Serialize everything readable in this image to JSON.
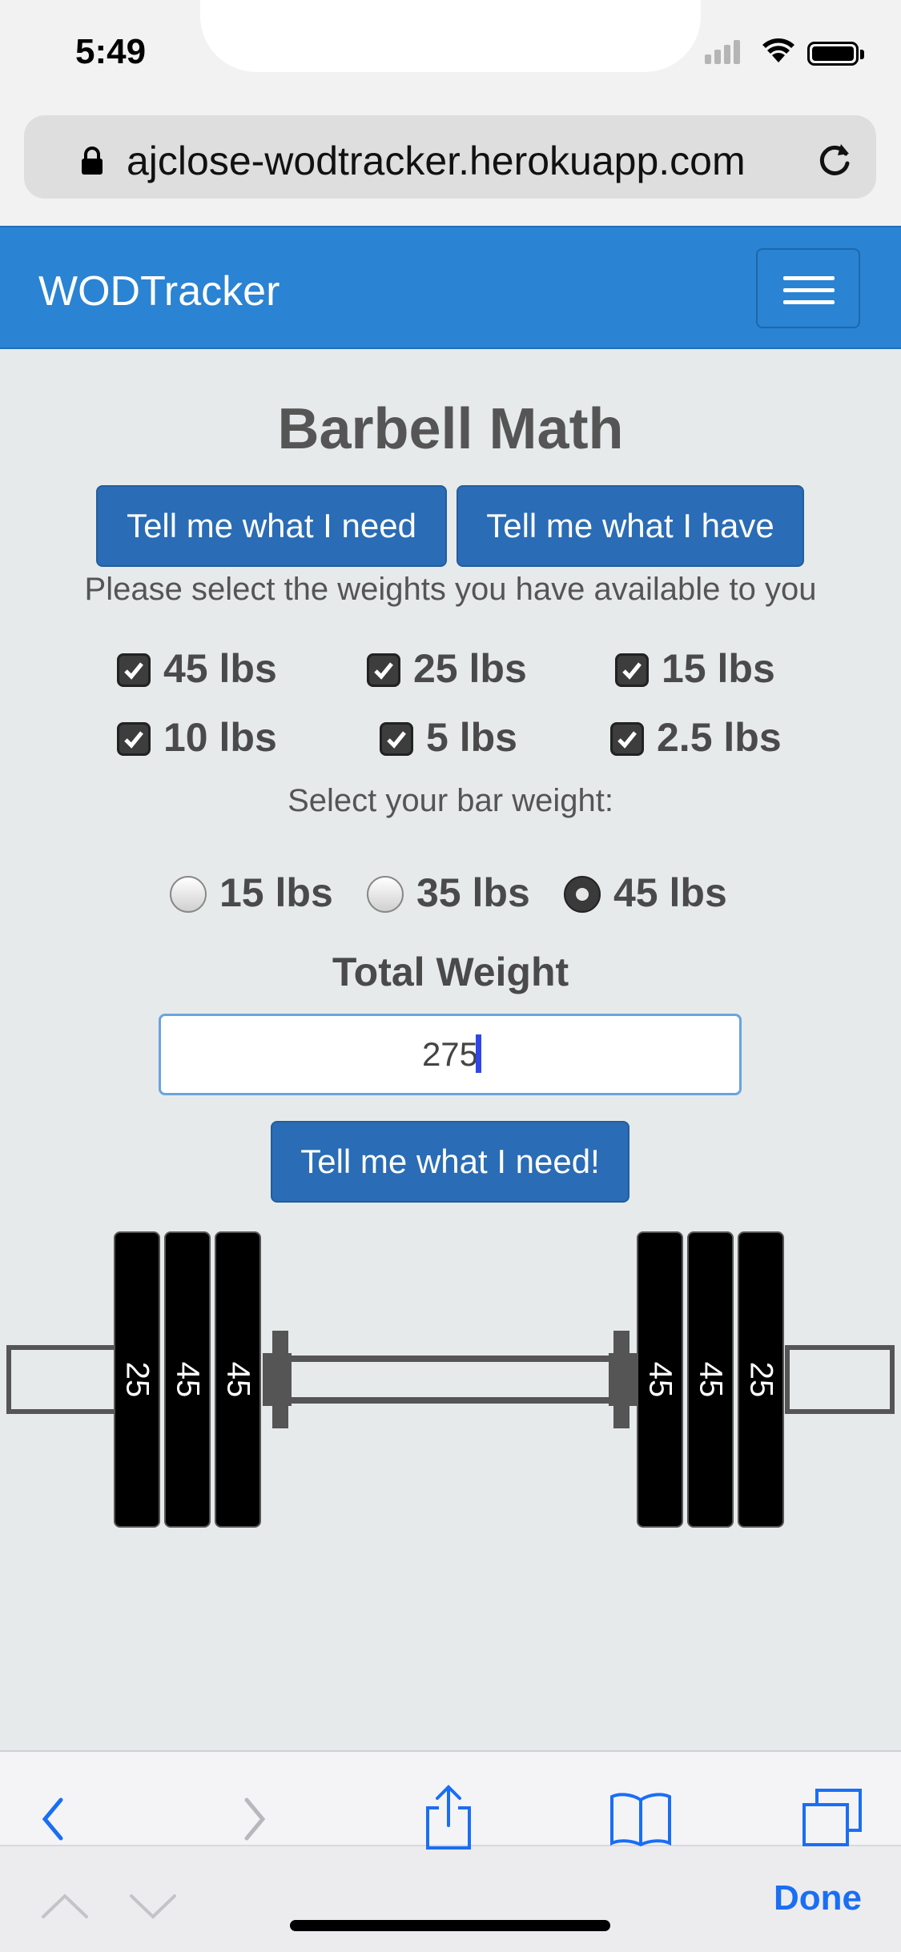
{
  "status_bar": {
    "time": "5:49",
    "icons": [
      "signal-icon",
      "wifi-icon",
      "battery-icon"
    ]
  },
  "browser": {
    "url": "ajclose-wodtracker.herokuapp.com",
    "lock_icon": "lock-icon",
    "reload_icon": "reload-icon"
  },
  "navbar": {
    "brand": "WODTracker",
    "menu_icon": "hamburger-menu-icon"
  },
  "page": {
    "title": "Barbell Math",
    "mode_buttons": {
      "need": "Tell me what I need",
      "have": "Tell me what I have"
    },
    "instructions": "Please select the weights you have available to you",
    "plates": [
      {
        "label": "45 lbs",
        "checked": true
      },
      {
        "label": "25 lbs",
        "checked": true
      },
      {
        "label": "15 lbs",
        "checked": true
      },
      {
        "label": "10 lbs",
        "checked": true
      },
      {
        "label": "5 lbs",
        "checked": true
      },
      {
        "label": "2.5 lbs",
        "checked": true
      }
    ],
    "bar_weight_label": "Select your bar weight:",
    "bar_weights": [
      {
        "label": "15 lbs",
        "selected": false
      },
      {
        "label": "35 lbs",
        "selected": false
      },
      {
        "label": "45 lbs",
        "selected": true
      }
    ],
    "total_weight_label": "Total Weight",
    "total_weight_value": "275",
    "calc_button": "Tell me what I need!",
    "barbell": {
      "left_plates": [
        "25",
        "45",
        "45"
      ],
      "right_plates": [
        "45",
        "45",
        "25"
      ]
    }
  },
  "safari_toolbar": {
    "icons": [
      "back-icon",
      "forward-icon",
      "share-icon",
      "bookmarks-icon",
      "tabs-icon"
    ],
    "keyboard_nav_icons": [
      "previous-field-icon",
      "next-field-icon"
    ],
    "done_label": "Done"
  },
  "colors": {
    "navbar": "#2a83d3",
    "button": "#2a6cb5",
    "background": "#e6eaeb",
    "done": "#1a6ef5"
  }
}
